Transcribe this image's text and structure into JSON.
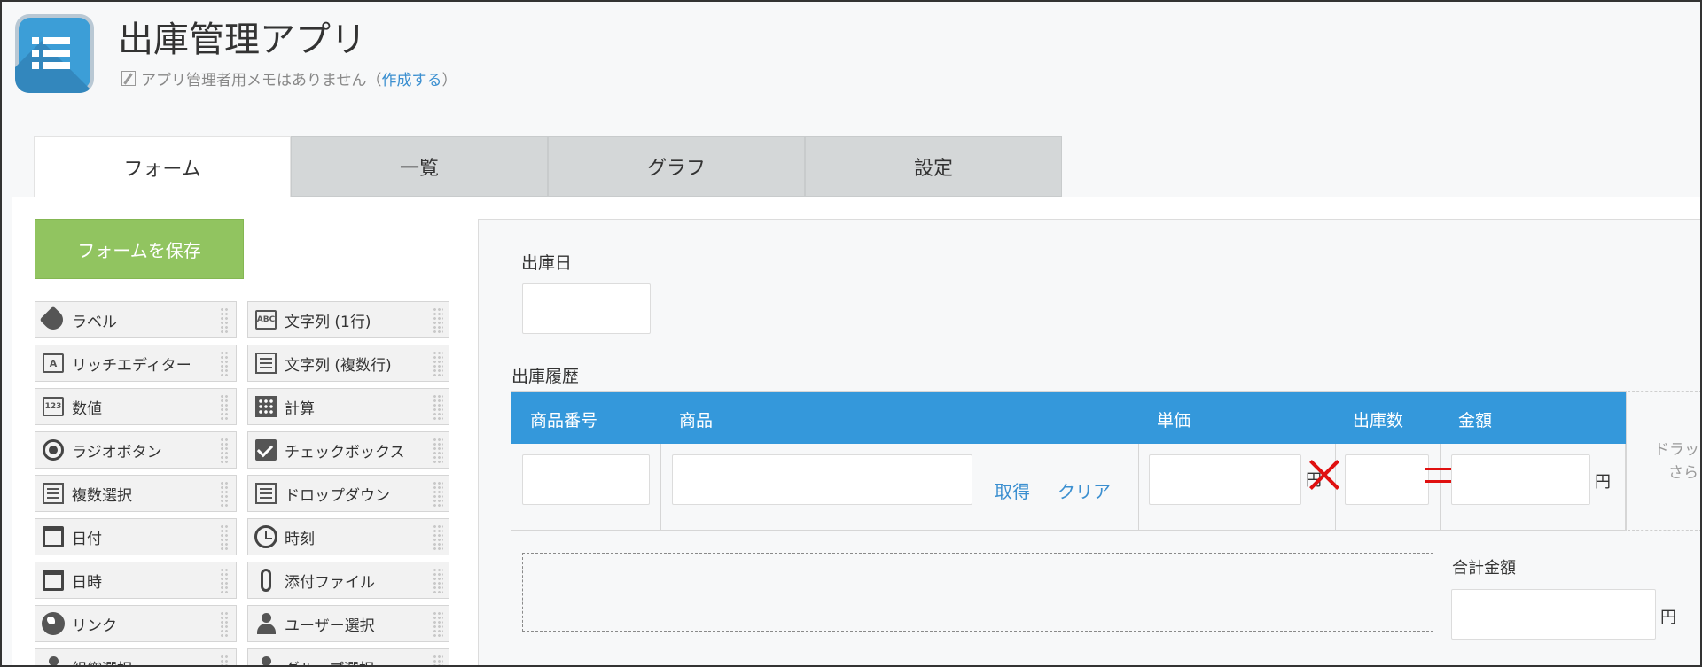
{
  "app": {
    "title": "出庫管理アプリ",
    "memo_text": "アプリ管理者用メモはありません",
    "memo_link_open": "（",
    "memo_link": "作成する",
    "memo_link_close": "）",
    "icon": "list-icon",
    "icon_color": "#3c9ed7"
  },
  "tabs": [
    {
      "label": "フォーム",
      "active": true
    },
    {
      "label": "一覧",
      "active": false
    },
    {
      "label": "グラフ",
      "active": false
    },
    {
      "label": "設定",
      "active": false
    }
  ],
  "save_button": {
    "label": "フォームを保存",
    "color": "#91c460"
  },
  "palette": [
    {
      "label": "ラベル",
      "icon": "tag-icon"
    },
    {
      "label": "文字列 (1行)",
      "icon": "abc-icon"
    },
    {
      "label": "リッチエディター",
      "icon": "rich-text-icon"
    },
    {
      "label": "文字列 (複数行)",
      "icon": "multiline-text-icon"
    },
    {
      "label": "数値",
      "icon": "number-icon"
    },
    {
      "label": "計算",
      "icon": "calculator-icon"
    },
    {
      "label": "ラジオボタン",
      "icon": "radio-icon"
    },
    {
      "label": "チェックボックス",
      "icon": "checkbox-icon"
    },
    {
      "label": "複数選択",
      "icon": "multi-select-icon"
    },
    {
      "label": "ドロップダウン",
      "icon": "dropdown-icon"
    },
    {
      "label": "日付",
      "icon": "calendar-icon"
    },
    {
      "label": "時刻",
      "icon": "clock-icon"
    },
    {
      "label": "日時",
      "icon": "datetime-icon"
    },
    {
      "label": "添付ファイル",
      "icon": "paperclip-icon"
    },
    {
      "label": "リンク",
      "icon": "globe-icon"
    },
    {
      "label": "ユーザー選択",
      "icon": "user-icon"
    },
    {
      "label": "組織選択",
      "icon": "org-icon"
    },
    {
      "label": "グループ選択",
      "icon": "group-icon"
    }
  ],
  "form": {
    "date_label": "出庫日",
    "history_label": "出庫履歴",
    "table_headers": {
      "code": "商品番号",
      "product": "商品",
      "price": "単価",
      "qty": "出庫数",
      "amount": "金額"
    },
    "fetch_link": "取得",
    "clear_link": "クリア",
    "yen": "円",
    "total_label": "合計金額",
    "drop_hint_line1": "ドラッ",
    "drop_hint_line2": "さら",
    "header_color": "#3498db",
    "annotation_color": "#e01010"
  }
}
